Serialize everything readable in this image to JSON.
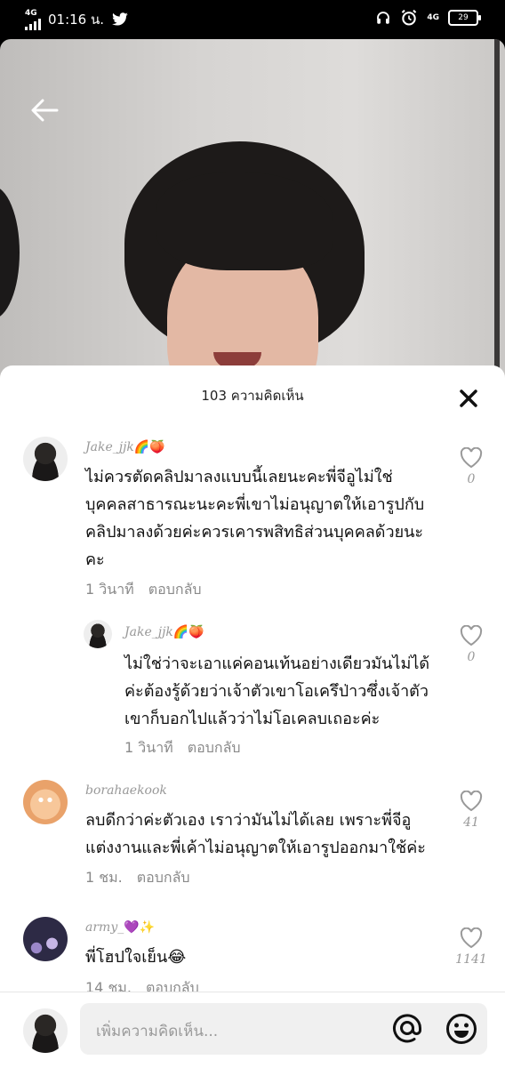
{
  "status_bar": {
    "network_left": "4G",
    "time": "01:16 น.",
    "network_right": "4G",
    "battery": "29"
  },
  "sheet": {
    "title": "103 ความคิดเห็น"
  },
  "comments": [
    {
      "username": "Jake_jjk",
      "username_emoji": "🌈🍑",
      "text": [
        "ไม่ควรตัดคลิปมาลงแบบนี้เลยนะคะพี่จีอูไม่ใช่",
        "บุคคลสาธารณะนะคะพี่เขาไม่อนุญาตให้เอารูปกับ",
        "คลิปมาลงด้วยค่ะควรเคารพสิทธิส่วนบุคคลด้วยนะ",
        "คะ"
      ],
      "time": "1 วินาที",
      "reply_label": "ตอบกลับ",
      "likes": "0"
    },
    {
      "username": "Jake_jjk",
      "username_emoji": "🌈🍑",
      "text": [
        "ไม่ใช่ว่าจะเอาแค่คอนเท้นอย่างเดียวมันไม่ได้",
        "ค่ะต้องรู้ด้วยว่าเจ้าตัวเขาโอเครึป่าวซึ่งเจ้าตัว",
        "เขาก็บอกไปแล้วว่าไม่โอเคลบเถอะค่ะ"
      ],
      "time": "1 วินาที",
      "reply_label": "ตอบกลับ",
      "likes": "0"
    },
    {
      "username": "borahaekook",
      "username_emoji": "",
      "text": [
        "ลบดีกว่าค่ะตัวเอง เราว่ามันไม่ได้เลย เพราะพี่จีอู",
        "แต่งงานและพี่เค้าไม่อนุญาตให้เอารูปออกมาใช้ค่ะ"
      ],
      "time": "1 ชม.",
      "reply_label": "ตอบกลับ",
      "likes": "41"
    },
    {
      "username": "army_",
      "username_emoji": "💜✨",
      "text": [
        "พี่โฮปใจเย็น😂"
      ],
      "time": "14 ชม.",
      "reply_label": "ตอบกลับ",
      "likes": "1141"
    }
  ],
  "input": {
    "placeholder": "เพิ่มความคิดเห็น..."
  },
  "icons": {
    "back": "arrow-left-icon",
    "close": "close-icon",
    "like": "heart-outline-icon",
    "mention": "at-sign-icon",
    "emoji": "smiley-icon"
  }
}
